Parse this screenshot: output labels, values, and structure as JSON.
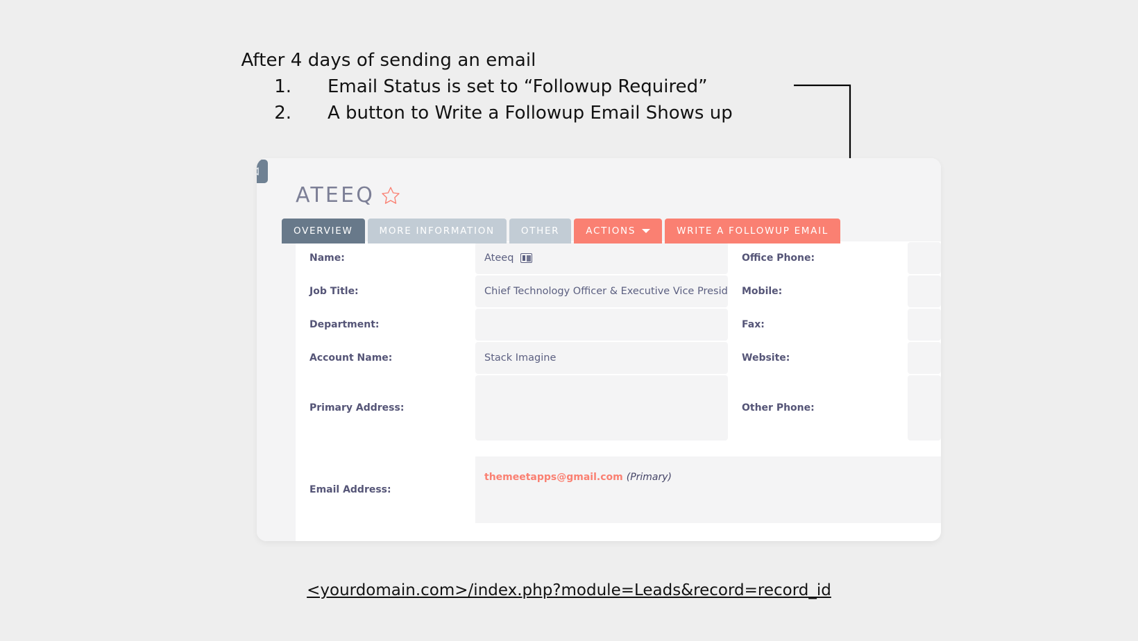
{
  "annotation": {
    "heading": "After 4 days of sending an email",
    "items": [
      {
        "number": "1.",
        "text": "Email Status is set to “Followup Required”"
      },
      {
        "number": "2.",
        "text": "A button to Write a Followup Email Shows up"
      }
    ]
  },
  "card": {
    "collapse_icon": "triangle-left-icon",
    "record_title": "ATEEQ",
    "favorite_icon": "star-outline-icon",
    "tabs": [
      {
        "label": "OVERVIEW",
        "state": "active"
      },
      {
        "label": "MORE INFORMATION",
        "state": "inactive"
      },
      {
        "label": "OTHER",
        "state": "inactive"
      },
      {
        "label": "ACTIONS",
        "state": "danger",
        "has_caret": true
      },
      {
        "label": "WRITE A FOLLOWUP EMAIL",
        "state": "danger"
      }
    ],
    "fields_left": [
      {
        "label": "Name:",
        "value": "Ateeq",
        "icon": "vcard-icon"
      },
      {
        "label": "Job Title:",
        "value": "Chief Technology Officer & Executive Vice President of Engineering"
      },
      {
        "label": "Department:",
        "value": ""
      },
      {
        "label": "Account Name:",
        "value": "Stack Imagine"
      },
      {
        "label": "Primary Address:",
        "value": ""
      }
    ],
    "fields_right": [
      {
        "label": "Office Phone:",
        "value": ""
      },
      {
        "label": "Mobile:",
        "value": ""
      },
      {
        "label": "Fax:",
        "value": ""
      },
      {
        "label": "Website:",
        "value": ""
      },
      {
        "label": "Other Phone:",
        "value": ""
      }
    ],
    "email_row": {
      "label": "Email Address:",
      "address": "themeetapps@gmail.com",
      "qualifier": "(Primary)"
    }
  },
  "url_caption": "<yourdomain.com>/index.php?module=Leads&record=record_id",
  "colors": {
    "page_bg": "#eeeeee",
    "card_bg": "#ffffff",
    "rail_bg": "#f4f4f5",
    "tab_active": "#68798a",
    "tab_inactive": "#c2ccd5",
    "accent_coral": "#fa8072",
    "label_text": "#555577",
    "value_text": "#5b5f80",
    "title_text": "#7c7f96"
  }
}
